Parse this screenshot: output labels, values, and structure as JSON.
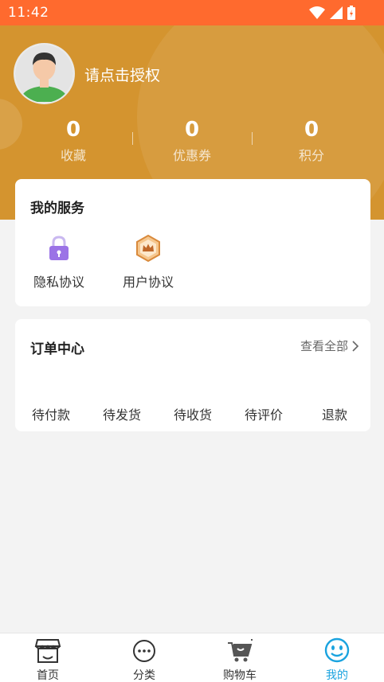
{
  "status_bar": {
    "time": "11:42"
  },
  "profile": {
    "username": "请点击授权"
  },
  "stats": [
    {
      "value": "0",
      "label": "收藏"
    },
    {
      "value": "0",
      "label": "优惠券"
    },
    {
      "value": "0",
      "label": "积分"
    }
  ],
  "services": {
    "title": "我的服务",
    "items": [
      {
        "label": "隐私协议",
        "icon": "lock-icon"
      },
      {
        "label": "用户协议",
        "icon": "crown-badge-icon"
      }
    ]
  },
  "orders": {
    "title": "订单中心",
    "view_all": "查看全部",
    "items": [
      {
        "label": "待付款"
      },
      {
        "label": "待发货"
      },
      {
        "label": "待收货"
      },
      {
        "label": "待评价"
      },
      {
        "label": "退款"
      }
    ]
  },
  "tabbar": {
    "items": [
      {
        "label": "首页",
        "icon": "shop-icon"
      },
      {
        "label": "分类",
        "icon": "chat-dots-icon"
      },
      {
        "label": "购物车",
        "icon": "cart-icon"
      },
      {
        "label": "我的",
        "icon": "face-icon"
      }
    ],
    "active_index": 3
  },
  "colors": {
    "status_bar": "#ff6a2e",
    "header": "#d4942f",
    "active_tab": "#1aa3df"
  }
}
